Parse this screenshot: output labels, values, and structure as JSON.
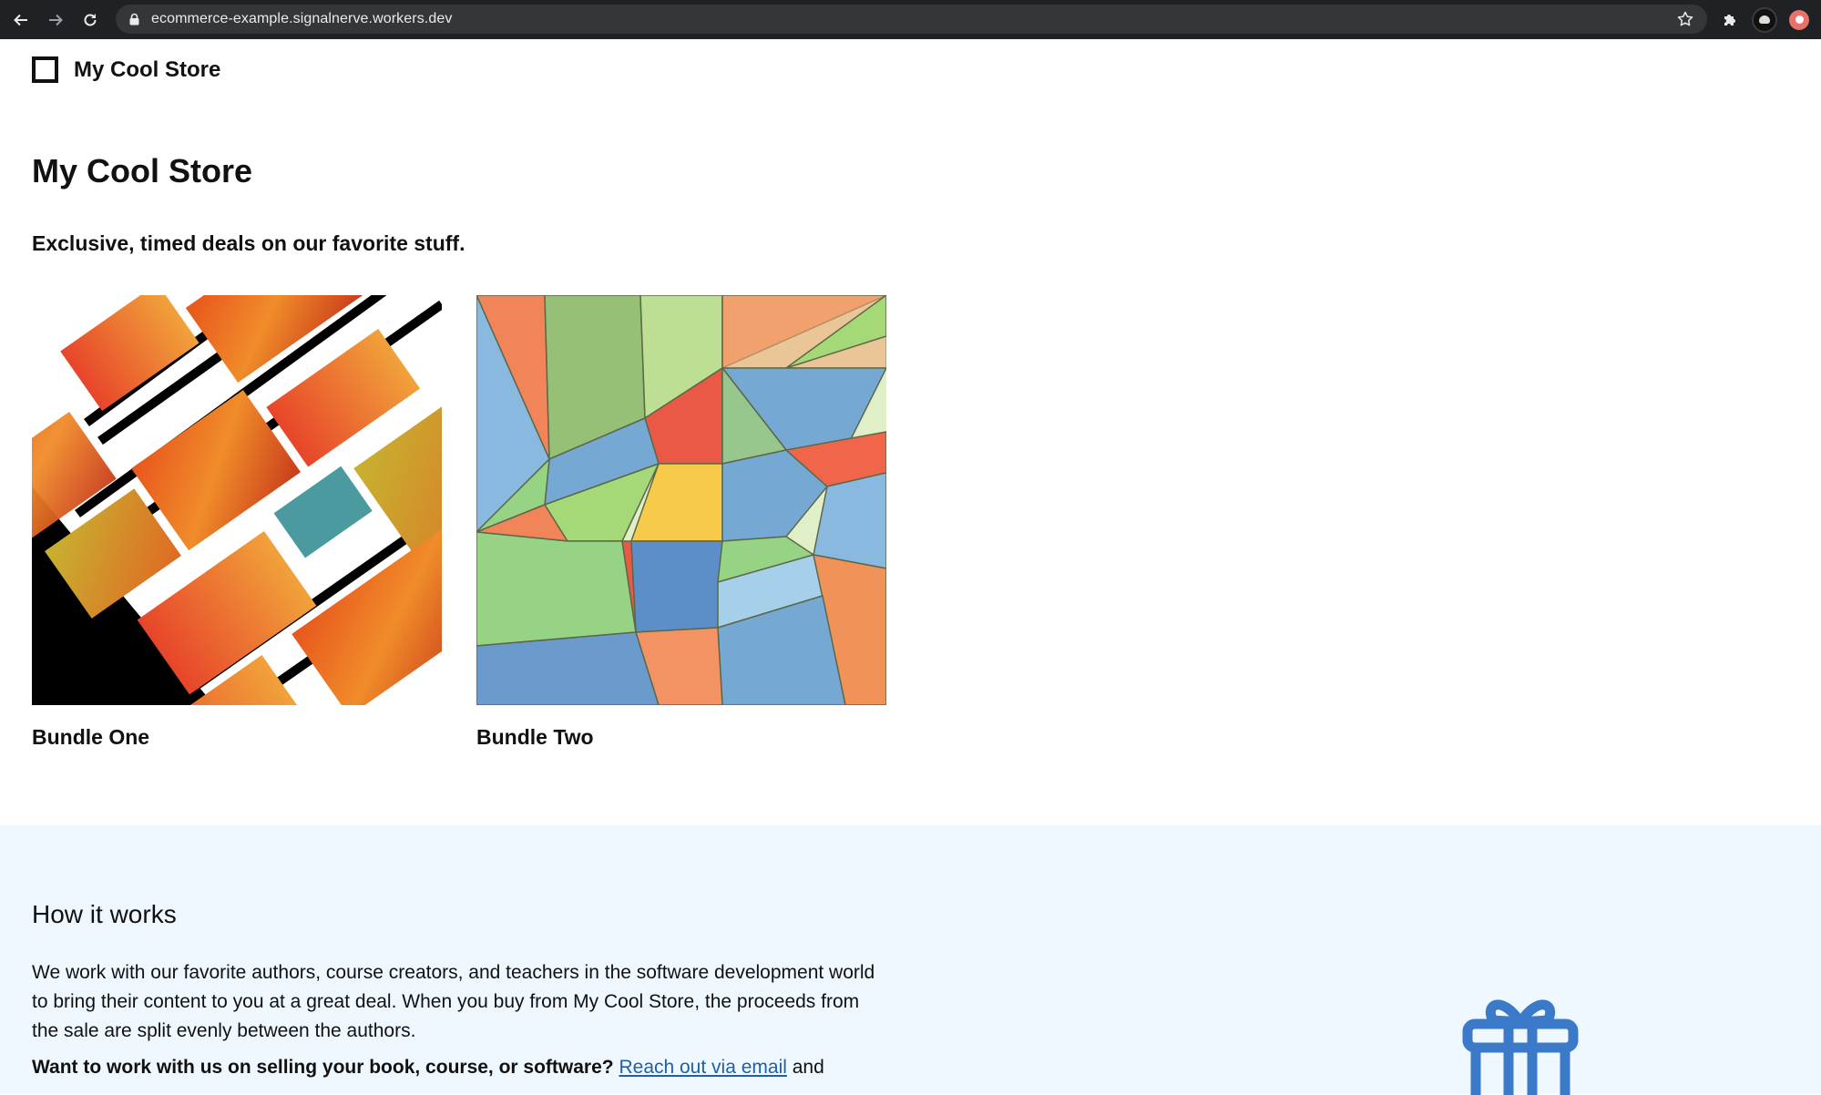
{
  "browser": {
    "url": "ecommerce-example.signalnerve.workers.dev",
    "icons": [
      "back-arrow-icon",
      "forward-arrow-icon",
      "reload-icon",
      "lock-icon",
      "bookmark-star-icon",
      "extensions-puzzle-icon",
      "profile-avatar-icon",
      "extension-badge-icon"
    ]
  },
  "header": {
    "logo_text": "My Cool Store"
  },
  "main": {
    "title": "My Cool Store",
    "tagline": "Exclusive, timed deals on our favorite stuff.",
    "products": [
      {
        "name": "Bundle One"
      },
      {
        "name": "Bundle Two"
      }
    ]
  },
  "how_it_works": {
    "title": "How it works",
    "body": "We work with our favorite authors, course creators, and teachers in the software development world to bring their content to you at a great deal. When you buy from My Cool Store, the proceeds from the sale are split evenly between the authors.",
    "cta_bold": "Want to work with us on selling your book, course, or software?",
    "cta_link": "Reach out via email",
    "cta_tail": "and",
    "icon": "gift-icon"
  },
  "colors": {
    "browser_bar": "#202124",
    "omnibox": "#35363a",
    "section_bg": "#eff8ff",
    "link": "#1f5fa8",
    "gift_icon": "#3b7ac9"
  }
}
